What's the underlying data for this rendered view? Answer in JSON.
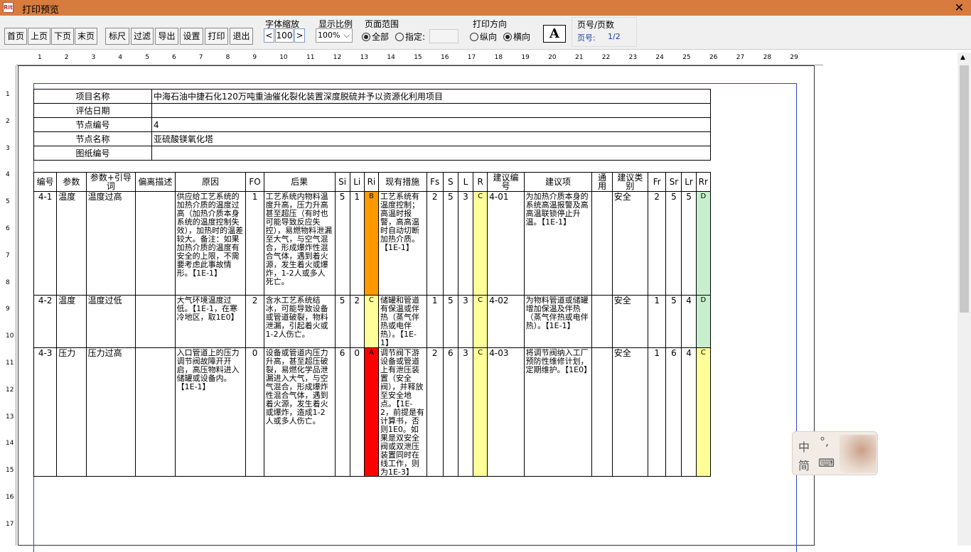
{
  "window": {
    "title": "打印预览",
    "close": "✕"
  },
  "toolbar": {
    "buttons": [
      "首页",
      "上页",
      "下页",
      "末页",
      "标尺",
      "过滤",
      "导出",
      "设置",
      "打印",
      "退出"
    ],
    "font_scale_label": "字体缩放",
    "font_scale_dec": "<",
    "font_scale_value": "100",
    "font_scale_inc": ">",
    "ratio_label": "显示比例",
    "ratio_value": "100%",
    "range_label": "页面范围",
    "range_all": "全部",
    "range_specify": "指定:",
    "orient_label": "打印方向",
    "orient_portrait": "纵向",
    "orient_landscape": "横向",
    "font_icon": "A",
    "page_label": "页号/页数",
    "page_text": "页号:",
    "page_value": "1/2"
  },
  "ruler": {
    "h": [
      "1",
      "2",
      "3",
      "4",
      "5",
      "6",
      "7",
      "8",
      "9",
      "10",
      "11",
      "12",
      "13",
      "14",
      "15",
      "16",
      "17",
      "18",
      "19",
      "20",
      "21",
      "22",
      "23",
      "24",
      "25",
      "26",
      "27",
      "28",
      "29"
    ],
    "v": [
      "1",
      "2",
      "3",
      "4",
      "5",
      "6",
      "7",
      "8",
      "9",
      "10",
      "11",
      "12",
      "13",
      "14",
      "15",
      "16",
      "17"
    ]
  },
  "info": [
    {
      "label": "项目名称",
      "value": "中海石油中捷石化120万吨重油催化裂化装置深度脱硫并予以资源化利用项目"
    },
    {
      "label": "评估日期",
      "value": ""
    },
    {
      "label": "节点编号",
      "value": "4"
    },
    {
      "label": "节点名称",
      "value": "亚硫酸镁氧化塔"
    },
    {
      "label": "图纸编号",
      "value": ""
    }
  ],
  "headers": [
    "编号",
    "参数",
    "参数+引导词",
    "偏离描述",
    "原因",
    "FO",
    "后果",
    "Si",
    "Li",
    "Ri",
    "现有措施",
    "Fs",
    "S",
    "L",
    "R",
    "建议编号",
    "建议项",
    "通用",
    "建议类别",
    "Fr",
    "Sr",
    "Lr",
    "Rr"
  ],
  "rows": [
    {
      "no": "4-1",
      "param": "温度",
      "guide": "温度过高",
      "dev": "",
      "cause": "供应给工艺系统的加热介质的温度过高（加热介质本身系统的温度控制失效），加热时的温差较大。备注：如果加热介质的温度有安全的上限，不需要考虑此事故情形。【1E-1】",
      "fo": "1",
      "cons": "工艺系统内物料温度升高，压力升高甚至超压（有时也可能导致反应失控），易燃物料泄漏至大气，与空气混合，形成爆炸性混合气体，遇到着火源，发生着火或爆炸，1-2人或多人死亡。",
      "si": "5",
      "li": "1",
      "ri": "B",
      "meas": "工艺系统有温度控制；高温时报警，高高温时自动切断加热介质。【1E-1】",
      "fs": "2",
      "s": "5",
      "l": "3",
      "r": "C",
      "sno": "4-01",
      "sug": "为加热介质本身的系统高温报警及高高温联锁停止升温。【1E-1】",
      "gen": "",
      "cat": "安全",
      "fr": "2",
      "sr": "5",
      "lr": "5",
      "rr": "D"
    },
    {
      "no": "4-2",
      "param": "温度",
      "guide": "温度过低",
      "dev": "",
      "cause": "大气环境温度过低。【1E-1，在寒冷地区，取1E0】",
      "fo": "2",
      "cons": "含水工艺系统结冰，可能导致设备或管道破裂，物料泄漏，引起着火或1-2人伤亡。",
      "si": "5",
      "li": "2",
      "ri": "C",
      "meas": "储罐和管道有保温或伴热（蒸气伴热或电伴热）。【1E-1】",
      "fs": "1",
      "s": "5",
      "l": "3",
      "r": "C",
      "sno": "4-02",
      "sug": "为物料管道或储罐增加保温及伴热（蒸气伴热或电伴热）。【1E-1】",
      "gen": "",
      "cat": "安全",
      "fr": "1",
      "sr": "5",
      "lr": "4",
      "rr": "D"
    },
    {
      "no": "4-3",
      "param": "压力",
      "guide": "压力过高",
      "dev": "",
      "cause": "入口管道上的压力调节阀故障开开启，高压物料进入储罐或设备内。【1E-1】",
      "fo": "0",
      "cons": "设备或管道内压力升高，甚至超压破裂，易燃化学品泄漏进入大气，与空气混合，形成爆炸性混合气体，遇到着火源，发生着火或爆炸，造成1-2人或多人伤亡。",
      "si": "6",
      "li": "0",
      "ri": "A",
      "meas": "调节阀下游设备或管道上有泄压装置（安全阀），并释放至安全地点。【1E-2，前提是有计算书，否则1E0。如果是双安全阀或双泄压装置同时在线工作，则为1E-3】",
      "fs": "2",
      "s": "6",
      "l": "3",
      "r": "C",
      "sno": "4-03",
      "sug": "将调节阀纳入工厂预防性维修计划，定期维护。【1E0】",
      "gen": "",
      "cat": "安全",
      "fr": "1",
      "sr": "6",
      "lr": "4",
      "rr": "C"
    }
  ],
  "ime": {
    "lang": "中",
    "punct": "°,",
    "mode": "简",
    "kbd": "⌨"
  },
  "colors": {
    "A": "#ff0000",
    "B": "#ff9900",
    "C": "#ffff99",
    "D": "#c6efce"
  }
}
